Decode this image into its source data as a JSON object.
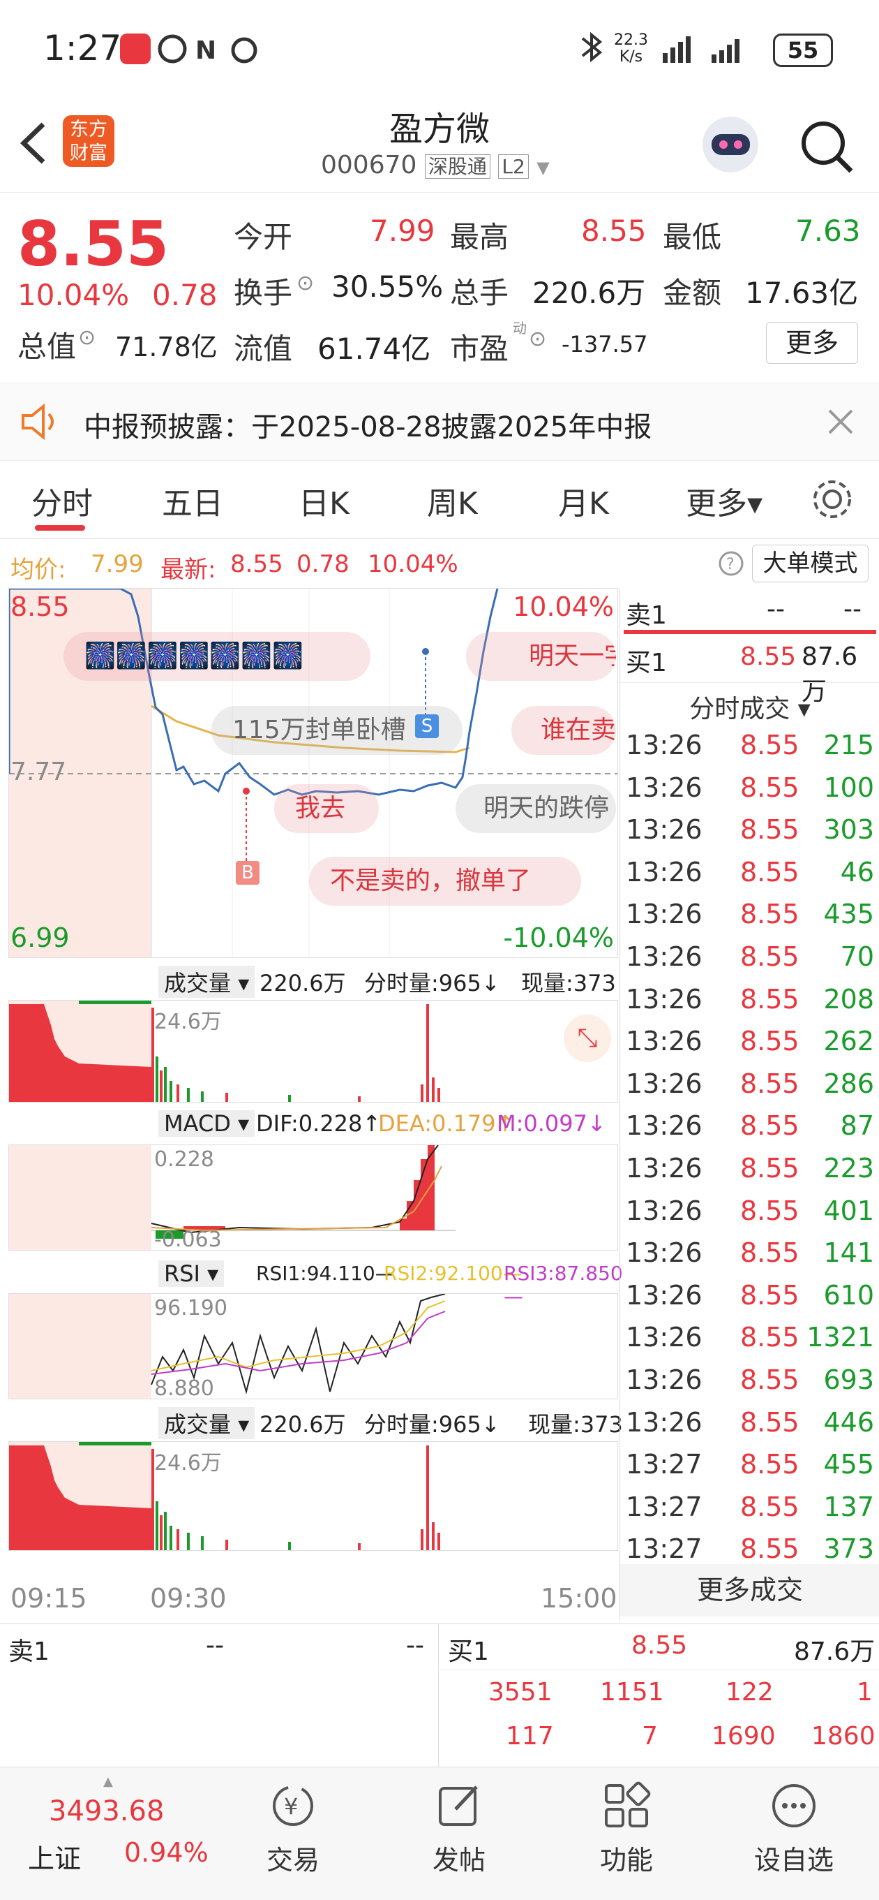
{
  "status_bar": {
    "time": "1:27",
    "net_speed_top": "22.3",
    "net_speed_bottom": "K/s",
    "battery": "55"
  },
  "header": {
    "logo_line1": "东方",
    "logo_line2": "财富",
    "title": "盈方微",
    "code": "000670",
    "tag1": "深股通",
    "tag2": "L2"
  },
  "quote": {
    "price": "8.55",
    "change_pct": "10.04%",
    "change_amt": "0.78",
    "open_label": "今开",
    "open": "7.99",
    "high_label": "最高",
    "high": "8.55",
    "low_label": "最低",
    "low": "7.63",
    "turnover_label": "换手",
    "turnover": "30.55%",
    "vol_label": "总手",
    "vol": "220.6万",
    "amount_label": "金额",
    "amount": "17.63亿",
    "mcap_label": "总值",
    "mcap": "71.78亿",
    "float_label": "流值",
    "float": "61.74亿",
    "pe_label": "市盈",
    "pe_sup": "动",
    "pe": "-137.57",
    "more": "更多"
  },
  "notice": {
    "text": "中报预披露：于2025-08-28披露2025年中报"
  },
  "tabs": [
    "分时",
    "五日",
    "日K",
    "周K",
    "月K",
    "更多▾"
  ],
  "avg_bar": {
    "avg_label": "均价:",
    "avg": "7.99",
    "latest_label": "最新:",
    "latest": "8.55",
    "chg": "0.78",
    "pct": "10.04%",
    "big_mode": "大单模式"
  },
  "chart": {
    "price_top": "8.55",
    "pct_top": "10.04%",
    "price_mid": "7.77",
    "price_bot": "6.99",
    "pct_bot": "-10.04%",
    "danmu": [
      "115万封单卧槽",
      "谁在卖",
      "我去",
      "明天的跌停",
      "不是卖的，撤单了",
      "明天一字"
    ],
    "marker_b": "B",
    "marker_s": "S",
    "vol_label": "成交量",
    "vol_total": "220.6万",
    "vol_min": "分时量:965↓",
    "vol_now": "现量:373",
    "vol_max": "24.6万",
    "macd_label": "MACD",
    "dif": "DIF:0.228↑",
    "dea": "DEA:0.179↑",
    "m": "M:0.097↓",
    "macd_max": "0.228",
    "macd_min": "-0.063",
    "rsi_label": "RSI",
    "rsi1": "RSI1:94.110—",
    "rsi2": "RSI2:92.100—",
    "rsi3": "RSI3:87.850—",
    "rsi_max": "96.190",
    "rsi_min": "8.880",
    "time_start": "09:15",
    "time_open": "09:30",
    "time_end": "15:00"
  },
  "colors": {
    "up": "#e8373e",
    "down": "#1a9b2c",
    "line": "#3a6db5",
    "avg": "#e6b34a"
  },
  "orderbook_top": {
    "sell_label": "卖1",
    "sell_price": "--",
    "sell_vol": "--",
    "buy_label": "买1",
    "buy_price": "8.55",
    "buy_vol": "87.6万"
  },
  "trades_header": "分时成交 ▾",
  "trades": [
    {
      "t": "13:26",
      "p": "8.55",
      "v": "215"
    },
    {
      "t": "13:26",
      "p": "8.55",
      "v": "100"
    },
    {
      "t": "13:26",
      "p": "8.55",
      "v": "303"
    },
    {
      "t": "13:26",
      "p": "8.55",
      "v": "46"
    },
    {
      "t": "13:26",
      "p": "8.55",
      "v": "435"
    },
    {
      "t": "13:26",
      "p": "8.55",
      "v": "70"
    },
    {
      "t": "13:26",
      "p": "8.55",
      "v": "208"
    },
    {
      "t": "13:26",
      "p": "8.55",
      "v": "262"
    },
    {
      "t": "13:26",
      "p": "8.55",
      "v": "286"
    },
    {
      "t": "13:26",
      "p": "8.55",
      "v": "87"
    },
    {
      "t": "13:26",
      "p": "8.55",
      "v": "223"
    },
    {
      "t": "13:26",
      "p": "8.55",
      "v": "401"
    },
    {
      "t": "13:26",
      "p": "8.55",
      "v": "141"
    },
    {
      "t": "13:26",
      "p": "8.55",
      "v": "610"
    },
    {
      "t": "13:26",
      "p": "8.55",
      "v": "1321"
    },
    {
      "t": "13:26",
      "p": "8.55",
      "v": "693"
    },
    {
      "t": "13:26",
      "p": "8.55",
      "v": "446"
    },
    {
      "t": "13:27",
      "p": "8.55",
      "v": "455"
    },
    {
      "t": "13:27",
      "p": "8.55",
      "v": "137"
    },
    {
      "t": "13:27",
      "p": "8.55",
      "v": "373"
    }
  ],
  "more_trades": "更多成交",
  "orderbook_bottom": {
    "sell_label": "卖1",
    "sell_price": "--",
    "sell_vol": "--",
    "buy_label": "买1",
    "buy_price": "8.55",
    "buy_vol": "87.6万",
    "queue_row1": [
      "3551",
      "1151",
      "122",
      "1"
    ],
    "queue_row2": [
      "117",
      "7",
      "1690",
      "1860"
    ]
  },
  "bottom_nav": {
    "index_value": "3493.68",
    "index_name": "上证",
    "index_pct": "0.94%",
    "trade": "交易",
    "post": "发帖",
    "func": "功能",
    "watch": "设自选"
  }
}
